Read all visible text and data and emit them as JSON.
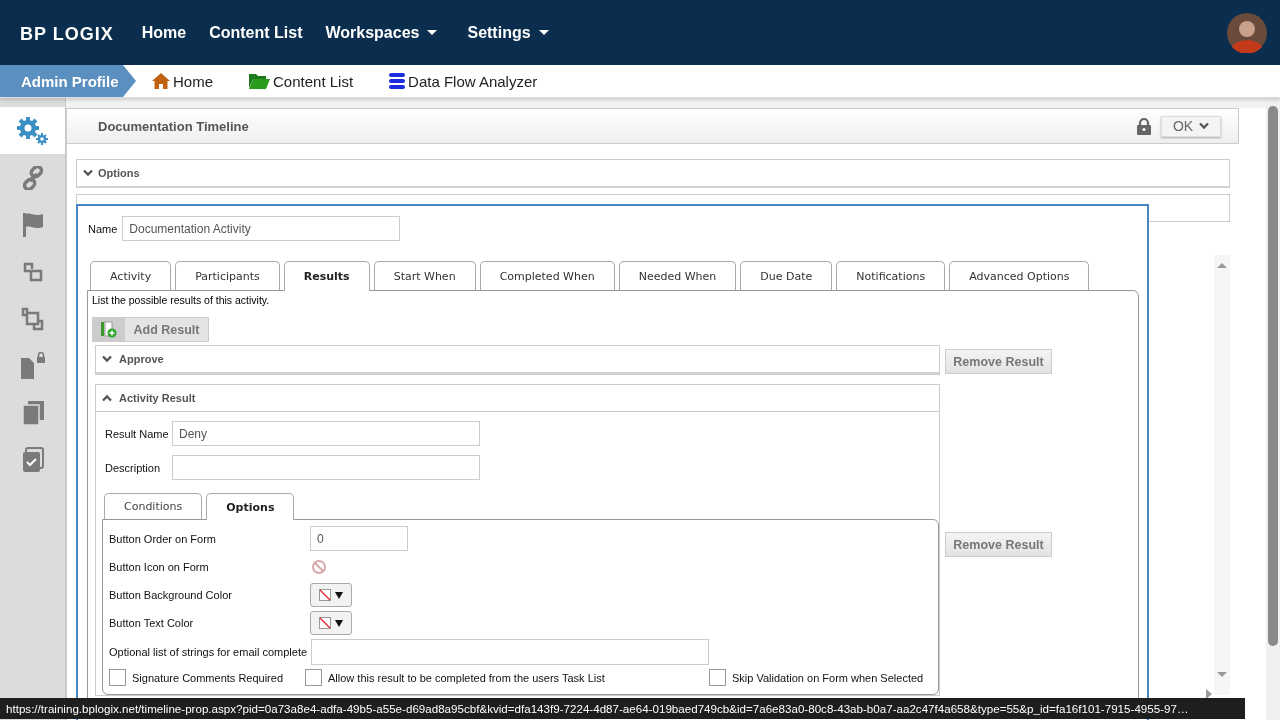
{
  "top_nav": {
    "logo": "BP LOGIX",
    "items": [
      {
        "label": "Home",
        "dropdown": false
      },
      {
        "label": "Content List",
        "dropdown": false
      },
      {
        "label": "Workspaces",
        "dropdown": true
      },
      {
        "label": "Settings",
        "dropdown": true
      }
    ]
  },
  "breadcrumb": {
    "profile": "Admin Profile",
    "items": [
      {
        "label": "Home",
        "kind": "home"
      },
      {
        "label": "Content List",
        "kind": "folder"
      },
      {
        "label": "Data Flow Analyzer",
        "kind": "database"
      }
    ]
  },
  "sidebar": {
    "items": [
      {
        "kind": "gears",
        "selected": true
      },
      {
        "kind": "link",
        "selected": false
      },
      {
        "kind": "flag",
        "selected": false
      },
      {
        "kind": "copy-small",
        "selected": false
      },
      {
        "kind": "copy",
        "selected": false
      },
      {
        "kind": "file-lock",
        "selected": false
      },
      {
        "kind": "files",
        "selected": false
      },
      {
        "kind": "file-check",
        "selected": false
      }
    ]
  },
  "panel": {
    "title": "Documentation Timeline",
    "ok_button": "OK",
    "sections": [
      {
        "label": "Options",
        "expanded": false
      }
    ]
  },
  "dialog": {
    "name_label": "Name",
    "name_value": "Documentation Activity",
    "tabs": [
      {
        "label": "Activity",
        "selected": false
      },
      {
        "label": "Participants",
        "selected": false
      },
      {
        "label": "Results",
        "selected": true
      },
      {
        "label": "Start When",
        "selected": false
      },
      {
        "label": "Completed When",
        "selected": false
      },
      {
        "label": "Needed When",
        "selected": false
      },
      {
        "label": "Due Date",
        "selected": false
      },
      {
        "label": "Notifications",
        "selected": false
      },
      {
        "label": "Advanced Options",
        "selected": false
      }
    ],
    "intro": "List the possible results of this activity.",
    "add_button": "Add Result",
    "results": [
      {
        "title": "Approve",
        "expanded": false,
        "remove_button": "Remove Result"
      },
      {
        "title": "Activity Result",
        "expanded": true,
        "remove_button": "Remove Result",
        "fields": [
          {
            "label": "Result Name",
            "value": "Deny"
          },
          {
            "label": "Description"
          }
        ],
        "subtabs": [
          {
            "label": "Conditions",
            "selected": false
          },
          {
            "label": "Options",
            "selected": true
          }
        ],
        "options": [
          {
            "kind": "text",
            "label": "Button Order on Form",
            "value": "0"
          },
          {
            "kind": "icon",
            "label": "Button Icon on Form"
          },
          {
            "kind": "color",
            "label": "Button Background Color"
          },
          {
            "kind": "color",
            "label": "Button Text Color"
          },
          {
            "kind": "wide-text",
            "label": "Optional list of strings for email complete"
          }
        ],
        "checkboxes": [
          {
            "label": "Signature Comments Required",
            "checked": false
          },
          {
            "label": "Allow this result to be completed from the users Task List",
            "checked": false
          },
          {
            "label": "Skip Validation on Form when Selected",
            "checked": false
          }
        ]
      }
    ]
  },
  "status_url": "https://training.bplogix.net/timeline-prop.aspx?pid=0a73a8e4-adfa-49b5-a55e-d69ad8a95cbf&kvid=dfa143f9-7224-4d87-ae64-019baed749cb&id=7a6e83a0-80c8-43ab-b0a7-aa2c47f4a658&type=55&p_id=fa16f101-7915-4955-97…"
}
